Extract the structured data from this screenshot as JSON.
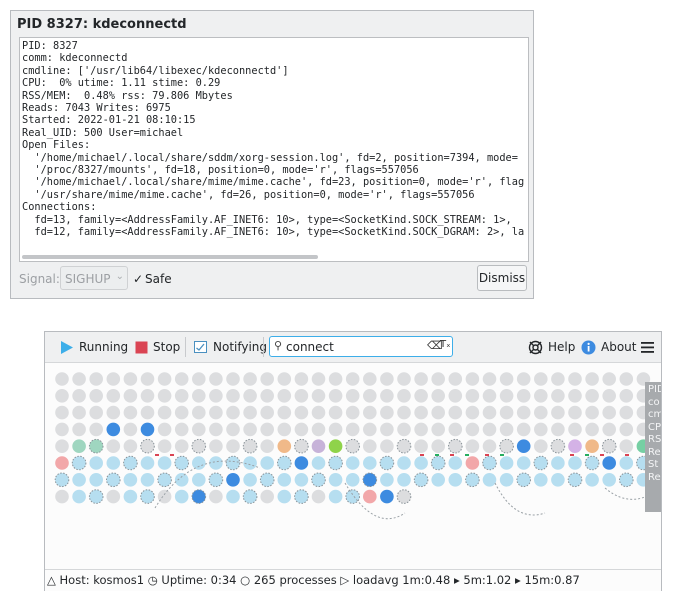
{
  "dialog": {
    "title": "PID 8327: kdeconnectd",
    "lines": [
      "PID: 8327",
      "comm: kdeconnectd",
      "cmdline: ['/usr/lib64/libexec/kdeconnectd']",
      "CPU:  0% utime: 1.11 stime: 0.29",
      "RSS/MEM:  0.48% rss: 79.806 Mbytes",
      "Reads: 7043 Writes: 6975",
      "Started: 2022-01-21 08:10:15",
      "Real_UID: 500 User=michael",
      "Open Files:",
      "  '/home/michael/.local/share/sddm/xorg-session.log', fd=2, position=7394, mode=",
      "  '/proc/8327/mounts', fd=18, position=0, mode='r', flags=557056",
      "  '/home/michael/.local/share/mime/mime.cache', fd=23, position=0, mode='r', flag",
      "  '/usr/share/mime/mime.cache', fd=26, position=0, mode='r', flags=557056",
      "Connections:",
      "  fd=13, family=<AddressFamily.AF_INET6: 10>, type=<SocketKind.SOCK_STREAM: 1>, ",
      "  fd=12, family=<AddressFamily.AF_INET6: 10>, type=<SocketKind.SOCK_DGRAM: 2>, la"
    ],
    "signal_label": "Signal:",
    "signal_value": "SIGHUP",
    "safe_label": "Safe",
    "dismiss_label": "Dismiss"
  },
  "toolbar": {
    "running_label": "Running",
    "stop_label": "Stop",
    "notifying_label": "Notifying",
    "search_value": "connect",
    "help_label": "Help",
    "about_label": "About"
  },
  "side_panel": [
    "PID",
    "co",
    "cm",
    "CP",
    "RS",
    "Re",
    "St",
    "Re"
  ],
  "status": {
    "host": "Host: kosmos1",
    "uptime": "Uptime: 0:34",
    "processes": "265 processes",
    "loadavg": "loadavg 1m:0.48",
    "m5": "5m:1.02",
    "m15": "15m:0.87"
  },
  "colors": {
    "accent": "#3daee9",
    "gray_dot": "#dcdddf",
    "light_blue_dot": "#b6def0",
    "blue_dot": "#3d8be0",
    "pink_dot": "#f2a7a9",
    "stop_red": "#da4453"
  },
  "icons": {
    "running": "play-icon",
    "stop": "stop-square-icon",
    "notifying": "notification-icon",
    "search": "search-icon",
    "clear": "clear-text-icon",
    "help": "lifebuoy-help-icon",
    "about": "info-icon",
    "menu": "hamburger-menu-icon"
  }
}
